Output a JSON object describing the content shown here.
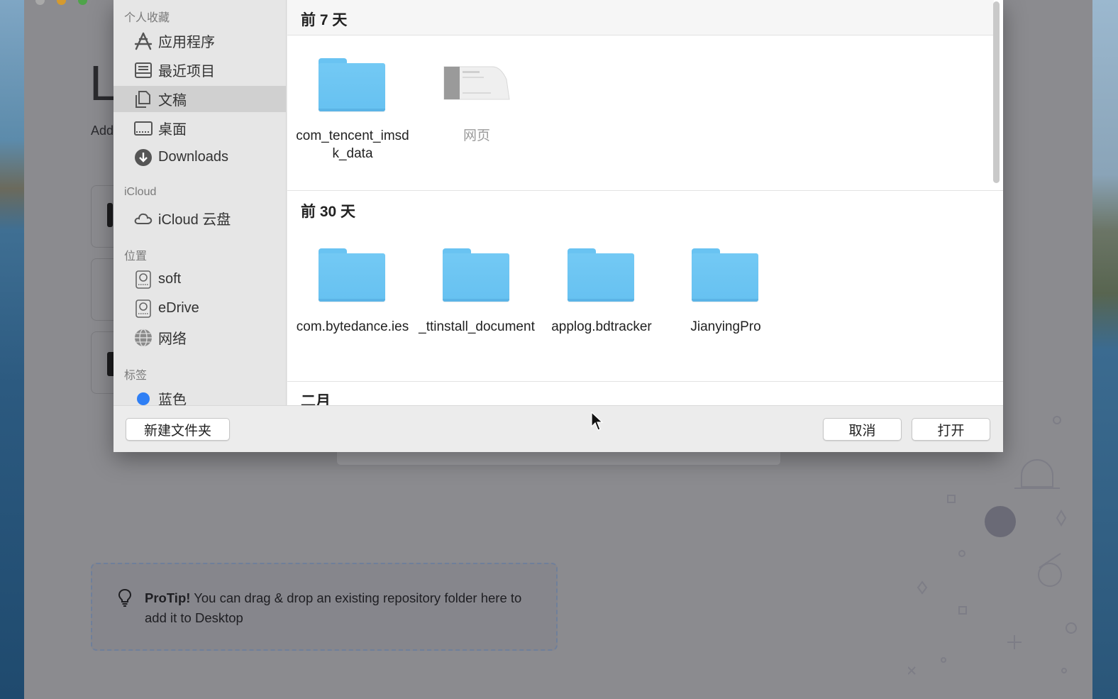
{
  "app": {
    "title_fragment": "L",
    "subtitle_fragment": "Add",
    "protip": {
      "bold": "ProTip!",
      "text": " You can drag & drop an existing repository folder here to add it to Desktop"
    }
  },
  "sidebar": {
    "favorites_heading": "个人收藏",
    "favorites": [
      {
        "label": "应用程序",
        "icon": "applications-icon"
      },
      {
        "label": "最近项目",
        "icon": "recents-icon"
      },
      {
        "label": "文稿",
        "icon": "documents-icon",
        "selected": true
      },
      {
        "label": "桌面",
        "icon": "desktop-icon"
      },
      {
        "label": "Downloads",
        "icon": "downloads-icon"
      }
    ],
    "icloud_heading": "iCloud",
    "icloud": [
      {
        "label": "iCloud 云盘",
        "icon": "icloud-drive-icon"
      }
    ],
    "locations_heading": "位置",
    "locations": [
      {
        "label": "soft",
        "icon": "disk-icon"
      },
      {
        "label": "eDrive",
        "icon": "disk-icon"
      },
      {
        "label": "网络",
        "icon": "network-icon"
      }
    ],
    "tags_heading": "标签",
    "tags": [
      {
        "label": "蓝色",
        "color": "#2f7ff5"
      }
    ]
  },
  "content": {
    "groups": [
      {
        "title": "前 7 天",
        "items": [
          {
            "name": "com_tencent_imsdk_data",
            "type": "folder"
          },
          {
            "name": "网页",
            "type": "document",
            "dim": true
          }
        ]
      },
      {
        "title": "前 30 天",
        "items": [
          {
            "name": "com.bytedance.ies",
            "type": "folder"
          },
          {
            "name": "_ttinstall_document",
            "type": "folder"
          },
          {
            "name": "applog.bdtracker",
            "type": "folder"
          },
          {
            "name": "JianyingPro",
            "type": "folder"
          }
        ]
      },
      {
        "title": "二月",
        "items": []
      }
    ]
  },
  "footer": {
    "new_folder": "新建文件夹",
    "cancel": "取消",
    "open": "打开"
  },
  "colors": {
    "folder_blue": "#69c3f2",
    "tag_blue": "#2f7ff5",
    "selection_gray": "#d0d0d0"
  }
}
